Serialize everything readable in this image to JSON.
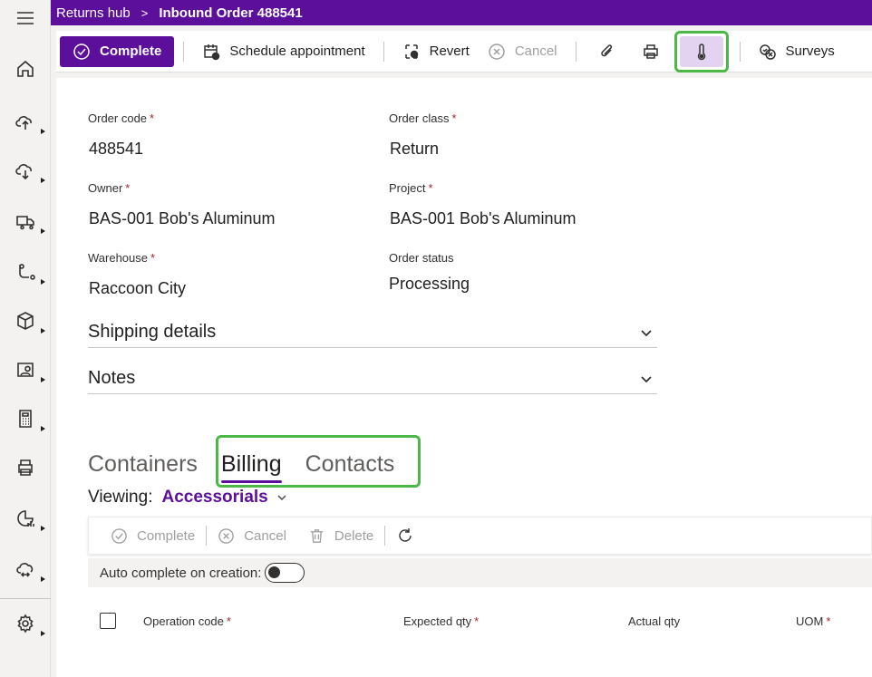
{
  "topbar": {
    "breadcrumb": "Returns hub",
    "separator": ">",
    "title": "Inbound Order 488541"
  },
  "toolbar": {
    "complete": "Complete",
    "schedule": "Schedule appointment",
    "revert": "Revert",
    "cancel": "Cancel",
    "surveys": "Surveys"
  },
  "form": {
    "order_code_label": "Order code",
    "order_code": "488541",
    "order_class_label": "Order class",
    "order_class": "Return",
    "owner_label": "Owner",
    "owner": "BAS-001 Bob's Aluminum",
    "project_label": "Project",
    "project": "BAS-001 Bob's Aluminum",
    "warehouse_label": "Warehouse",
    "warehouse": "Raccoon City",
    "status_label": "Order status",
    "status": "Processing",
    "required_mark": "*"
  },
  "sections": {
    "shipping": "Shipping details",
    "notes": "Notes"
  },
  "tabs": [
    "Containers",
    "Billing",
    "Contacts"
  ],
  "viewing": {
    "label": "Viewing:",
    "value": "Accessorials"
  },
  "subtoolbar": {
    "complete": "Complete",
    "cancel": "Cancel",
    "delete": "Delete"
  },
  "auto_complete_label": "Auto complete on creation:",
  "grid": {
    "columns": [
      "Operation code",
      "Expected qty",
      "Actual qty",
      "UOM"
    ]
  },
  "colors": {
    "brand": "#5c0f9a",
    "highlight": "#4cb848",
    "required": "#a4262c"
  }
}
